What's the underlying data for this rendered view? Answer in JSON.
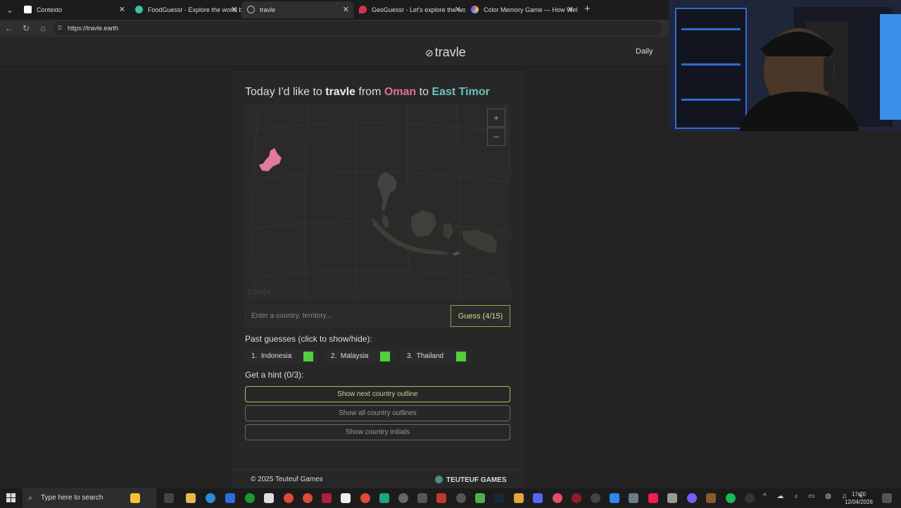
{
  "browser": {
    "tabs": [
      {
        "title": "Contexto",
        "color": "#ffffff"
      },
      {
        "title": "FoodGuessr - Explore the world b",
        "color": "#3cc1a5"
      },
      {
        "title": "travle",
        "color": "#bbbbbb"
      },
      {
        "title": "GeoGuessr - Let's explore the wo",
        "color": "#d8324f"
      },
      {
        "title": "Color Memory Game — How Well",
        "color": "#e0508a"
      }
    ],
    "active_tab": 2,
    "url": "https://travle.earth"
  },
  "site": {
    "logo": "travle",
    "nav_daily": "Daily"
  },
  "game": {
    "title_prefix": "Today I'd like to",
    "title_game": "travle",
    "title_from_word": "from",
    "from_country": "Oman",
    "title_to_word": "to",
    "to_country": "East Timor",
    "map_watermark": "travle",
    "input_placeholder": "Enter a country, territory...",
    "guess_button": "Guess (4/15)",
    "past_label": "Past guesses (click to show/hide):",
    "past_guesses": [
      {
        "num": "1.",
        "name": "Indonesia",
        "status_color": "#4fd13a"
      },
      {
        "num": "2.",
        "name": "Malaysia",
        "status_color": "#4fd13a"
      },
      {
        "num": "3.",
        "name": "Thailand",
        "status_color": "#4fd13a"
      }
    ],
    "hint_label": "Get a hint (0/3):",
    "hints": [
      "Show next country outline",
      "Show all country outlines",
      "Show country initials"
    ],
    "zoom_in": "+",
    "zoom_out": "−"
  },
  "footer": {
    "copyright": "© 2025 Teuteuf Games",
    "studio": "TEUTEUF GAMES"
  },
  "taskbar": {
    "search_placeholder": "Type here to search",
    "time": "17:20",
    "date": "12/04/2026"
  },
  "colors": {
    "from": "#e06d9c",
    "to": "#6cc2b6",
    "correct": "#4fd13a",
    "accent_border": "#b8b860"
  }
}
